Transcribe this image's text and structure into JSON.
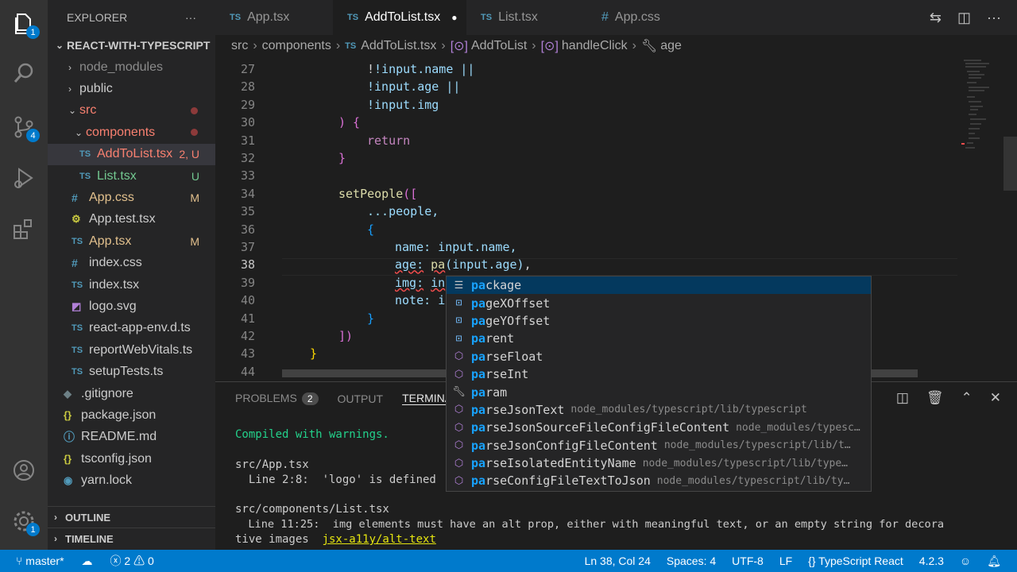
{
  "activity": {
    "explorer_badge": "1",
    "scm_badge": "4",
    "settings_badge": "1"
  },
  "sidebar": {
    "header": "EXPLORER",
    "more": "···",
    "project": "REACT-WITH-TYPESCRIPT",
    "items": [
      {
        "label": "node_modules",
        "status": ""
      },
      {
        "label": "public",
        "status": ""
      },
      {
        "label": "src",
        "status": ""
      },
      {
        "label": "components",
        "status": ""
      },
      {
        "label": "AddToList.tsx",
        "status": "2, U"
      },
      {
        "label": "List.tsx",
        "status": "U"
      },
      {
        "label": "App.css",
        "status": "M"
      },
      {
        "label": "App.test.tsx",
        "status": ""
      },
      {
        "label": "App.tsx",
        "status": "M"
      },
      {
        "label": "index.css",
        "status": ""
      },
      {
        "label": "index.tsx",
        "status": ""
      },
      {
        "label": "logo.svg",
        "status": ""
      },
      {
        "label": "react-app-env.d.ts",
        "status": ""
      },
      {
        "label": "reportWebVitals.ts",
        "status": ""
      },
      {
        "label": "setupTests.ts",
        "status": ""
      },
      {
        "label": ".gitignore",
        "status": ""
      },
      {
        "label": "package.json",
        "status": ""
      },
      {
        "label": "README.md",
        "status": ""
      },
      {
        "label": "tsconfig.json",
        "status": ""
      },
      {
        "label": "yarn.lock",
        "status": ""
      }
    ],
    "outline": "OUTLINE",
    "timeline": "TIMELINE"
  },
  "tabs": [
    {
      "icon": "TS",
      "label": "App.tsx"
    },
    {
      "icon": "TS",
      "label": "AddToList.tsx"
    },
    {
      "icon": "TS",
      "label": "List.tsx"
    },
    {
      "icon": "#",
      "label": "App.css"
    }
  ],
  "breadcrumb": {
    "a": "src",
    "b": "components",
    "c_icon": "TS",
    "c": "AddToList.tsx",
    "d": "AddToList",
    "e": "handleClick",
    "f": "age"
  },
  "editor": {
    "line_numbers": [
      "27",
      "28",
      "29",
      "30",
      "31",
      "32",
      "33",
      "34",
      "35",
      "36",
      "37",
      "38",
      "39",
      "40",
      "41",
      "42",
      "43",
      "44"
    ],
    "lines": {
      "l27": "!input.name ||",
      "l28": "!input.age ||",
      "l29": "!input.img",
      "l30a": ")",
      "l30b": " {",
      "l31": "return",
      "l32": "}",
      "l34a": "setPeople",
      "l34b": "([",
      "l35": "...people,",
      "l36": "{",
      "l37a": "name:",
      "l37b": " input.name,",
      "l38a": "age:",
      "l38b": "pa",
      "l38c": "(input.age)",
      "l38d": ",",
      "l39a": "img:",
      "l39b": "in",
      "l40a": "note:",
      "l40b": "i",
      "l41": "}",
      "l42": "])",
      "l43": "}"
    }
  },
  "suggest": [
    {
      "icon": "keyword",
      "match": "pa",
      "rest": "ckage",
      "detail": ""
    },
    {
      "icon": "variable",
      "match": "pa",
      "rest": "geXOffset",
      "detail": ""
    },
    {
      "icon": "variable",
      "match": "pa",
      "rest": "geYOffset",
      "detail": ""
    },
    {
      "icon": "variable",
      "match": "pa",
      "rest": "rent",
      "detail": ""
    },
    {
      "icon": "function",
      "match": "pa",
      "rest": "rseFloat",
      "detail": ""
    },
    {
      "icon": "function",
      "match": "pa",
      "rest": "rseInt",
      "detail": ""
    },
    {
      "icon": "snippet",
      "match": "pa",
      "rest": "ram",
      "detail": ""
    },
    {
      "icon": "function",
      "match": "pa",
      "rest": "rseJsonText",
      "detail": "node_modules/typescript/lib/typescript"
    },
    {
      "icon": "function",
      "match": "pa",
      "rest": "rseJsonSourceFileConfigFileContent",
      "detail": "node_modules/typesc…"
    },
    {
      "icon": "function",
      "match": "pa",
      "rest": "rseJsonConfigFileContent",
      "detail": "node_modules/typescript/lib/t…"
    },
    {
      "icon": "function",
      "match": "pa",
      "rest": "rseIsolatedEntityName",
      "detail": "node_modules/typescript/lib/type…"
    },
    {
      "icon": "function",
      "match": "pa",
      "rest": "rseConfigFileTextToJson",
      "detail": "node_modules/typescript/lib/ty…"
    }
  ],
  "panel": {
    "problems": "PROBLEMS",
    "problems_count": "2",
    "output": "OUTPUT",
    "terminal": "TERMINA",
    "lines": [
      "Compiled with warnings.",
      "src/App.tsx",
      "  Line 2:8:  'logo' is defined",
      "src/components/List.tsx",
      "  Line 11:25:  img elements must have an alt prop, either with meaningful text, or an empty string for decora",
      "tive images  ",
      "jsx-a11y/alt-text"
    ]
  },
  "status": {
    "branch": "master*",
    "errors": "2",
    "warnings": "0",
    "position": "Ln 38, Col 24",
    "spaces": "Spaces: 4",
    "encoding": "UTF-8",
    "eol": "LF",
    "language": "TypeScript React",
    "version": "4.2.3"
  },
  "colors": {
    "accent": "#007acc",
    "activity_bg": "#333333",
    "sidebar_bg": "#252526",
    "editor_bg": "#1e1e1e",
    "untracked": "#73c991",
    "modified": "#e2c08d",
    "error": "#f14c4c"
  }
}
